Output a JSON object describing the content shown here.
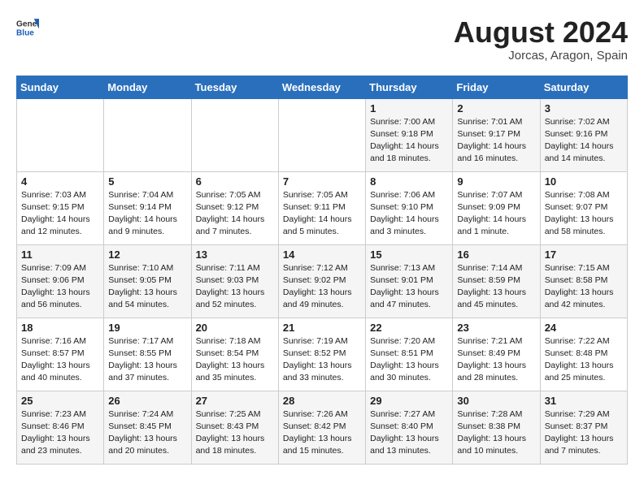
{
  "header": {
    "logo_general": "General",
    "logo_blue": "Blue",
    "month_year": "August 2024",
    "location": "Jorcas, Aragon, Spain"
  },
  "days_of_week": [
    "Sunday",
    "Monday",
    "Tuesday",
    "Wednesday",
    "Thursday",
    "Friday",
    "Saturday"
  ],
  "weeks": [
    {
      "days": [
        {
          "num": "",
          "info": ""
        },
        {
          "num": "",
          "info": ""
        },
        {
          "num": "",
          "info": ""
        },
        {
          "num": "",
          "info": ""
        },
        {
          "num": "1",
          "info": "Sunrise: 7:00 AM\nSunset: 9:18 PM\nDaylight: 14 hours\nand 18 minutes."
        },
        {
          "num": "2",
          "info": "Sunrise: 7:01 AM\nSunset: 9:17 PM\nDaylight: 14 hours\nand 16 minutes."
        },
        {
          "num": "3",
          "info": "Sunrise: 7:02 AM\nSunset: 9:16 PM\nDaylight: 14 hours\nand 14 minutes."
        }
      ]
    },
    {
      "days": [
        {
          "num": "4",
          "info": "Sunrise: 7:03 AM\nSunset: 9:15 PM\nDaylight: 14 hours\nand 12 minutes."
        },
        {
          "num": "5",
          "info": "Sunrise: 7:04 AM\nSunset: 9:14 PM\nDaylight: 14 hours\nand 9 minutes."
        },
        {
          "num": "6",
          "info": "Sunrise: 7:05 AM\nSunset: 9:12 PM\nDaylight: 14 hours\nand 7 minutes."
        },
        {
          "num": "7",
          "info": "Sunrise: 7:05 AM\nSunset: 9:11 PM\nDaylight: 14 hours\nand 5 minutes."
        },
        {
          "num": "8",
          "info": "Sunrise: 7:06 AM\nSunset: 9:10 PM\nDaylight: 14 hours\nand 3 minutes."
        },
        {
          "num": "9",
          "info": "Sunrise: 7:07 AM\nSunset: 9:09 PM\nDaylight: 14 hours\nand 1 minute."
        },
        {
          "num": "10",
          "info": "Sunrise: 7:08 AM\nSunset: 9:07 PM\nDaylight: 13 hours\nand 58 minutes."
        }
      ]
    },
    {
      "days": [
        {
          "num": "11",
          "info": "Sunrise: 7:09 AM\nSunset: 9:06 PM\nDaylight: 13 hours\nand 56 minutes."
        },
        {
          "num": "12",
          "info": "Sunrise: 7:10 AM\nSunset: 9:05 PM\nDaylight: 13 hours\nand 54 minutes."
        },
        {
          "num": "13",
          "info": "Sunrise: 7:11 AM\nSunset: 9:03 PM\nDaylight: 13 hours\nand 52 minutes."
        },
        {
          "num": "14",
          "info": "Sunrise: 7:12 AM\nSunset: 9:02 PM\nDaylight: 13 hours\nand 49 minutes."
        },
        {
          "num": "15",
          "info": "Sunrise: 7:13 AM\nSunset: 9:01 PM\nDaylight: 13 hours\nand 47 minutes."
        },
        {
          "num": "16",
          "info": "Sunrise: 7:14 AM\nSunset: 8:59 PM\nDaylight: 13 hours\nand 45 minutes."
        },
        {
          "num": "17",
          "info": "Sunrise: 7:15 AM\nSunset: 8:58 PM\nDaylight: 13 hours\nand 42 minutes."
        }
      ]
    },
    {
      "days": [
        {
          "num": "18",
          "info": "Sunrise: 7:16 AM\nSunset: 8:57 PM\nDaylight: 13 hours\nand 40 minutes."
        },
        {
          "num": "19",
          "info": "Sunrise: 7:17 AM\nSunset: 8:55 PM\nDaylight: 13 hours\nand 37 minutes."
        },
        {
          "num": "20",
          "info": "Sunrise: 7:18 AM\nSunset: 8:54 PM\nDaylight: 13 hours\nand 35 minutes."
        },
        {
          "num": "21",
          "info": "Sunrise: 7:19 AM\nSunset: 8:52 PM\nDaylight: 13 hours\nand 33 minutes."
        },
        {
          "num": "22",
          "info": "Sunrise: 7:20 AM\nSunset: 8:51 PM\nDaylight: 13 hours\nand 30 minutes."
        },
        {
          "num": "23",
          "info": "Sunrise: 7:21 AM\nSunset: 8:49 PM\nDaylight: 13 hours\nand 28 minutes."
        },
        {
          "num": "24",
          "info": "Sunrise: 7:22 AM\nSunset: 8:48 PM\nDaylight: 13 hours\nand 25 minutes."
        }
      ]
    },
    {
      "days": [
        {
          "num": "25",
          "info": "Sunrise: 7:23 AM\nSunset: 8:46 PM\nDaylight: 13 hours\nand 23 minutes."
        },
        {
          "num": "26",
          "info": "Sunrise: 7:24 AM\nSunset: 8:45 PM\nDaylight: 13 hours\nand 20 minutes."
        },
        {
          "num": "27",
          "info": "Sunrise: 7:25 AM\nSunset: 8:43 PM\nDaylight: 13 hours\nand 18 minutes."
        },
        {
          "num": "28",
          "info": "Sunrise: 7:26 AM\nSunset: 8:42 PM\nDaylight: 13 hours\nand 15 minutes."
        },
        {
          "num": "29",
          "info": "Sunrise: 7:27 AM\nSunset: 8:40 PM\nDaylight: 13 hours\nand 13 minutes."
        },
        {
          "num": "30",
          "info": "Sunrise: 7:28 AM\nSunset: 8:38 PM\nDaylight: 13 hours\nand 10 minutes."
        },
        {
          "num": "31",
          "info": "Sunrise: 7:29 AM\nSunset: 8:37 PM\nDaylight: 13 hours\nand 7 minutes."
        }
      ]
    }
  ]
}
